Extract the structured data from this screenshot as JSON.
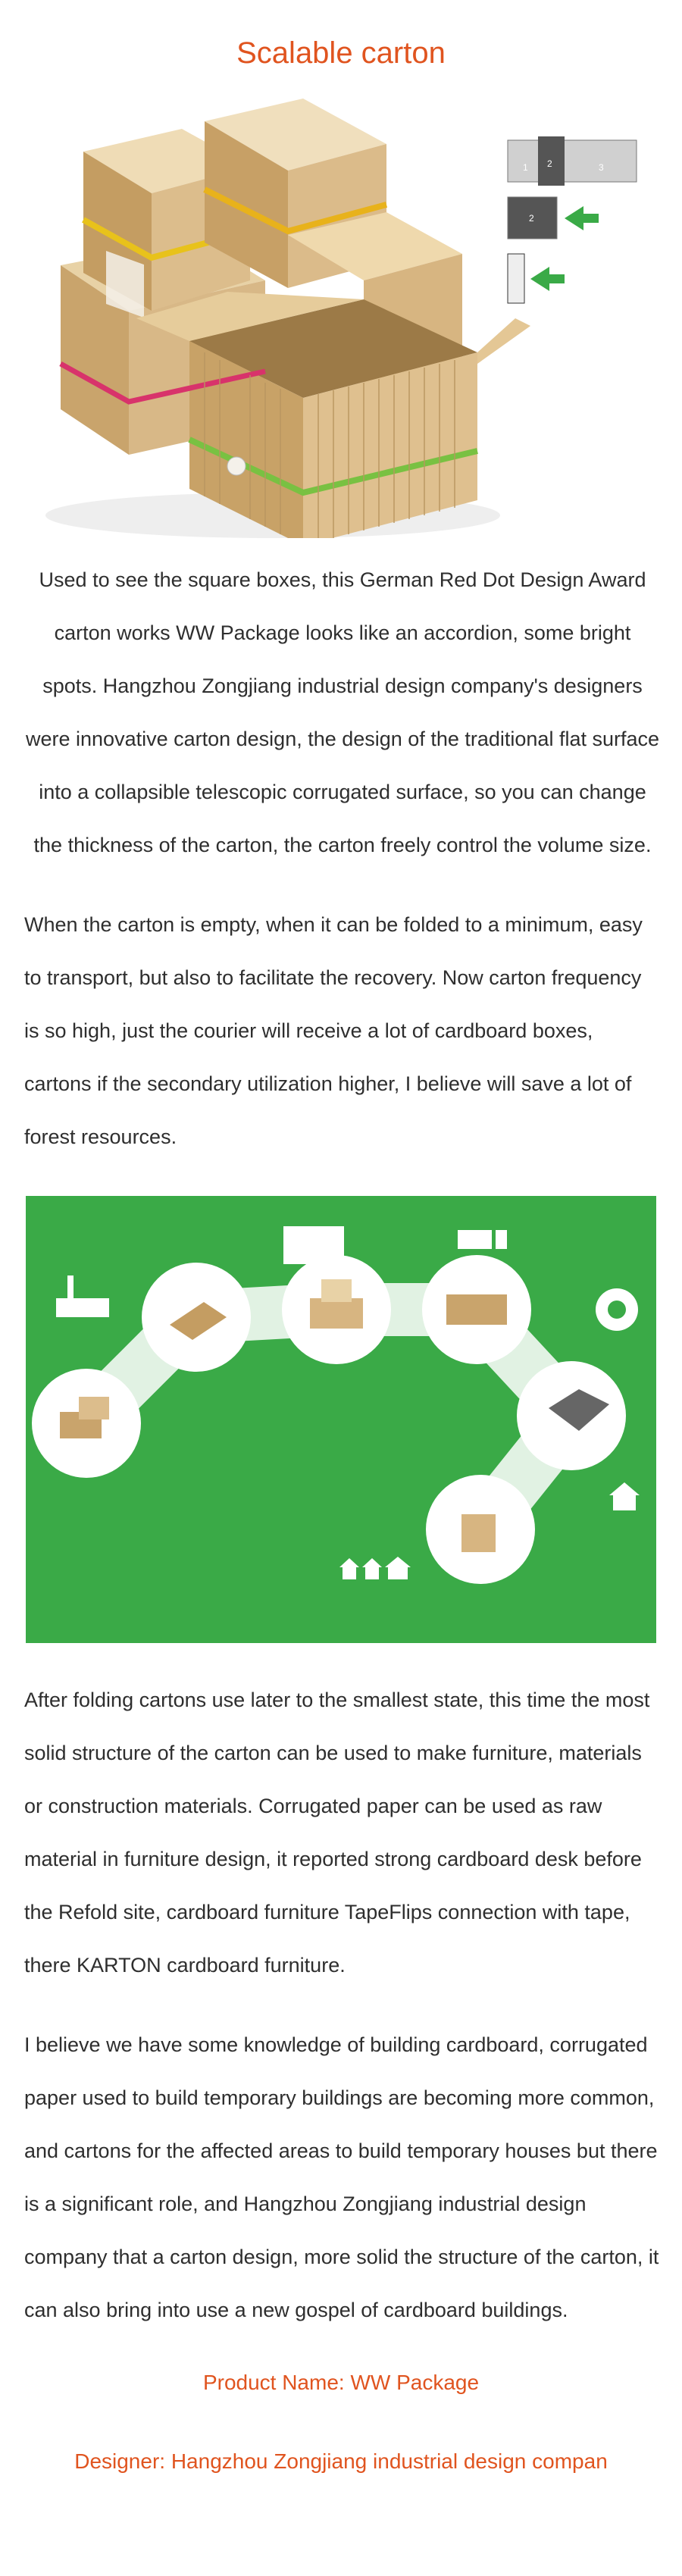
{
  "page": {
    "title": "Scalable carton"
  },
  "hero_diagram": {
    "labels": [
      "1",
      "2",
      "3",
      "2"
    ]
  },
  "paragraphs": {
    "p1": "Used to see the square boxes, this German Red Dot Design Award carton works WW Package looks like an accordion, some bright spots. Hangzhou Zongjiang industrial design company's designers were innovative carton design, the design of the traditional flat surface into a collapsible telescopic corrugated surface, so you can change the thickness of the carton, the carton freely control the volume size.",
    "p2": "When the carton is empty, when it can be folded to a minimum, easy to transport, but also to facilitate the recovery. Now carton frequency is so high, just the courier will receive a lot of cardboard boxes, cartons if the secondary utilization higher, I believe will save a lot of forest resources.",
    "p3": "After folding cartons use later to the smallest state, this time the most solid structure of the carton can be used to make furniture, materials or construction materials. Corrugated paper can be used as raw material in furniture design, it reported strong cardboard desk before the Refold site, cardboard furniture TapeFlips connection with tape, there KARTON cardboard furniture.",
    "p4": "I believe we have some knowledge of building cardboard, corrugated paper used to build temporary buildings are becoming more common, and cartons for the affected areas to build temporary houses but there is a significant role, and Hangzhou Zongjiang industrial design company that a carton design, more solid the structure of the carton, it can also bring into use a new gospel of cardboard buildings."
  },
  "footer": {
    "product": "Product Name: WW Package",
    "designer": "Designer: Hangzhou Zongjiang industrial design compan"
  },
  "colors": {
    "accent": "#e0541f",
    "green": "#3aaa47",
    "cardboard": "#d7b98a"
  }
}
